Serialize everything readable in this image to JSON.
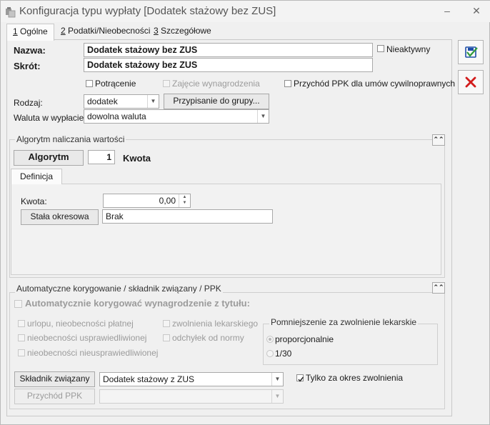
{
  "window": {
    "title": "Konfiguracja typu wypłaty [Dodatek stażowy bez ZUS]",
    "minimize": "–",
    "close": "✕"
  },
  "tabs": [
    {
      "key": "1",
      "label": " Ogólne"
    },
    {
      "key": "2",
      "label": " Podatki/Nieobecności"
    },
    {
      "key": "3",
      "label": " Szczegółowe"
    }
  ],
  "general": {
    "name_label": "Nazwa:",
    "name_value": "Dodatek stażowy bez ZUS",
    "short_label": "Skrót:",
    "short_value": "Dodatek stażowy bez ZUS",
    "inactive_label": "Nieaktywny",
    "deduction_label": "Potrącenie",
    "seizure_label": "Zajęcie wynagrodzenia",
    "ppk_income_label": "Przychód PPK dla umów cywilnoprawnych",
    "type_label": "Rodzaj:",
    "type_value": "dodatek",
    "assign_group_button": "Przypisanie do grupy...",
    "currency_label": "Waluta w wypłacie:",
    "currency_value": "dowolna waluta"
  },
  "algorithm": {
    "section_title": "Algorytm naliczania wartości",
    "button": "Algorytm",
    "number": "1",
    "name": "Kwota",
    "definition_tab": "Definicja",
    "amount_label": "Kwota:",
    "amount_value": "0,00",
    "constant_button": "Stała okresowa",
    "constant_value": "Brak"
  },
  "correction": {
    "section_title": "Automatyczne korygowanie / składnik związany / PPK",
    "auto_label": "Automatycznie korygować wynagrodzenie z tytułu:",
    "opt_paid_leave": "urlopu, nieobecności płatnej",
    "opt_justified": "nieobecności usprawiedliwionej",
    "opt_unjustified": "nieobecności nieusprawiedliwionej",
    "opt_sick_leave": "zwolnienia lekarskiego",
    "opt_deviation": "odchyłek od normy",
    "reduction_title": "Pomniejszenie za zwolnienie lekarskie",
    "proportional": "proporcjonalnie",
    "one_thirtieth": "1/30",
    "related_button": "Składnik związany",
    "related_value": "Dodatek stażowy z ZUS",
    "only_period_label": "Tylko za okres zwolnienia",
    "ppk_button": "Przychód PPK",
    "ppk_value": ""
  },
  "colors": {
    "save_accent": "#1f4fa8",
    "cancel_accent": "#d21c1c"
  }
}
